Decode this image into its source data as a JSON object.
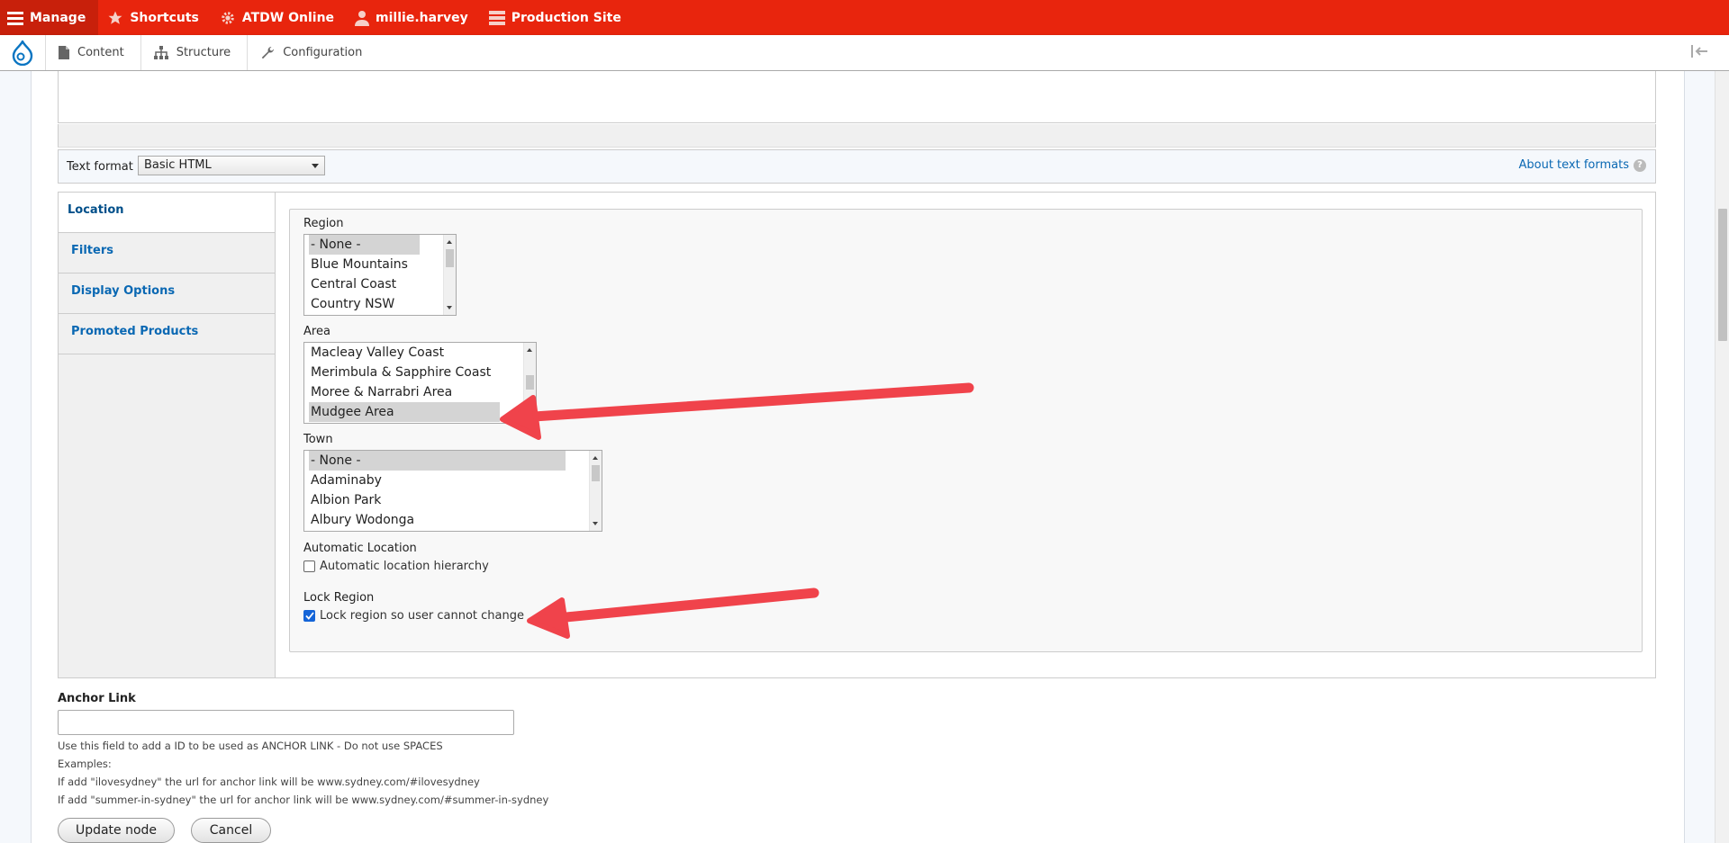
{
  "toolbar": {
    "manage": "Manage",
    "shortcuts": "Shortcuts",
    "site": "ATDW Online",
    "user": "millie.harvey",
    "env": "Production Site"
  },
  "tray": {
    "content": "Content",
    "structure": "Structure",
    "configuration": "Configuration"
  },
  "text_format": {
    "label": "Text format",
    "value": "Basic HTML",
    "about_link": "About text formats"
  },
  "vertical_tabs": [
    {
      "label": "Location"
    },
    {
      "label": "Filters"
    },
    {
      "label": "Display Options"
    },
    {
      "label": "Promoted Products"
    }
  ],
  "location": {
    "region": {
      "label": "Region",
      "options": [
        "- None -",
        "Blue Mountains",
        "Central Coast",
        "Country NSW"
      ],
      "selected": "- None -"
    },
    "area": {
      "label": "Area",
      "options": [
        "Macleay Valley Coast",
        "Merimbula & Sapphire Coast",
        "Moree & Narrabri Area",
        "Mudgee Area"
      ],
      "selected": "Mudgee Area"
    },
    "town": {
      "label": "Town",
      "options": [
        "- None -",
        "Adaminaby",
        "Albion Park",
        "Albury Wodonga"
      ],
      "selected": "- None -"
    },
    "automatic_location": {
      "title": "Automatic Location",
      "checkbox_label": "Automatic location hierarchy",
      "checked": false
    },
    "lock_region": {
      "title": "Lock Region",
      "checkbox_label": "Lock region so user cannot change",
      "checked": true
    }
  },
  "anchor_link": {
    "label": "Anchor Link",
    "value": "",
    "help_lines": [
      "Use this field to add a ID to be used as ANCHOR LINK - Do not use SPACES",
      "Examples:",
      "If add \"ilovesydney\" the url for anchor link will be www.sydney.com/#ilovesydney",
      "If add \"summer-in-sydney\" the url for anchor link will be www.sydney.com/#summer-in-sydney"
    ]
  },
  "actions": {
    "update": "Update node",
    "cancel": "Cancel"
  },
  "colors": {
    "toolbar": "#e8250d",
    "link": "#0a68b3",
    "annotation_arrow": "#f0434b"
  }
}
